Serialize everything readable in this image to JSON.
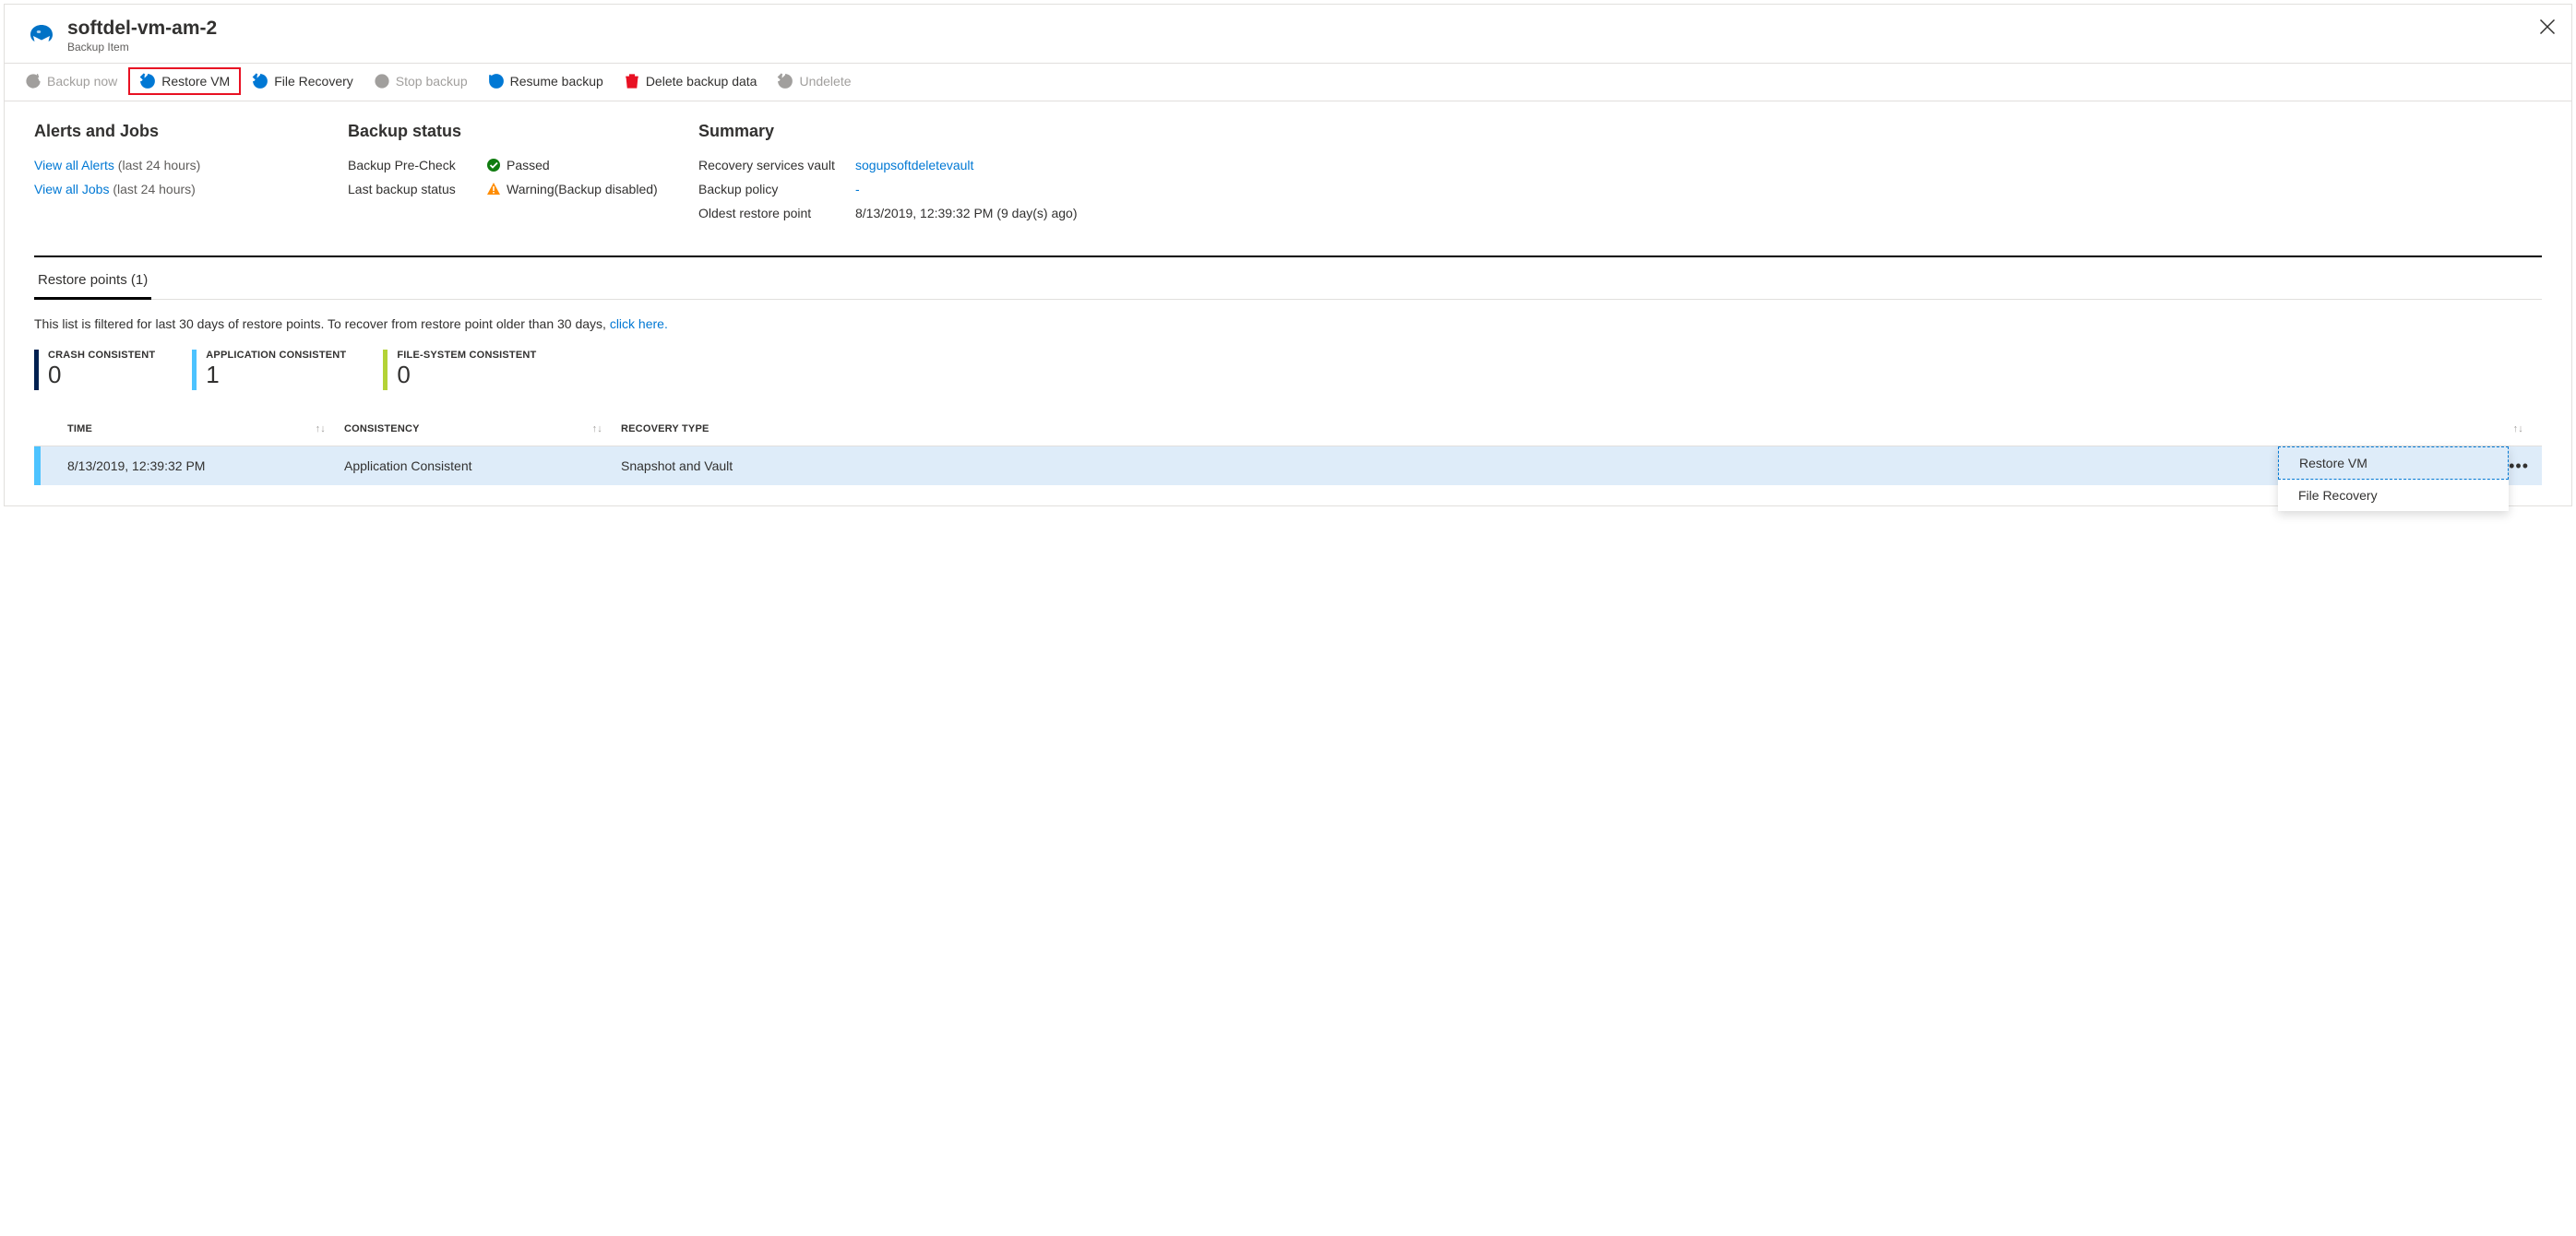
{
  "header": {
    "title": "softdel-vm-am-2",
    "subtitle": "Backup Item"
  },
  "toolbar": {
    "backup_now": "Backup now",
    "restore_vm": "Restore VM",
    "file_recovery": "File Recovery",
    "stop_backup": "Stop backup",
    "resume_backup": "Resume backup",
    "delete_backup_data": "Delete backup data",
    "undelete": "Undelete"
  },
  "alerts_section": {
    "title": "Alerts and Jobs",
    "view_alerts": "View all Alerts",
    "view_alerts_suffix": "(last 24 hours)",
    "view_jobs": "View all Jobs",
    "view_jobs_suffix": "(last 24 hours)"
  },
  "status_section": {
    "title": "Backup status",
    "precheck_label": "Backup Pre-Check",
    "precheck_value": "Passed",
    "last_backup_label": "Last backup status",
    "last_backup_value": "Warning(Backup disabled)"
  },
  "summary_section": {
    "title": "Summary",
    "vault_label": "Recovery services vault",
    "vault_value": "sogupsoftdeletevault",
    "policy_label": "Backup policy",
    "policy_value": "-",
    "oldest_label": "Oldest restore point",
    "oldest_value": "8/13/2019, 12:39:32 PM (9 day(s) ago)"
  },
  "tabs": {
    "restore_points": "Restore points (1)"
  },
  "filter_note_prefix": "This list is filtered for last 30 days of restore points. To recover from restore point older than 30 days, ",
  "filter_note_link": "click here.",
  "counters": {
    "crash_label": "CRASH CONSISTENT",
    "crash_value": "0",
    "app_label": "APPLICATION CONSISTENT",
    "app_value": "1",
    "fs_label": "FILE-SYSTEM CONSISTENT",
    "fs_value": "0"
  },
  "grid": {
    "col_time": "TIME",
    "col_consistency": "CONSISTENCY",
    "col_recovery": "RECOVERY TYPE",
    "row0": {
      "time": "8/13/2019, 12:39:32 PM",
      "consistency": "Application Consistent",
      "recovery": "Snapshot and Vault"
    }
  },
  "context_menu": {
    "restore_vm": "Restore VM",
    "file_recovery": "File Recovery"
  }
}
